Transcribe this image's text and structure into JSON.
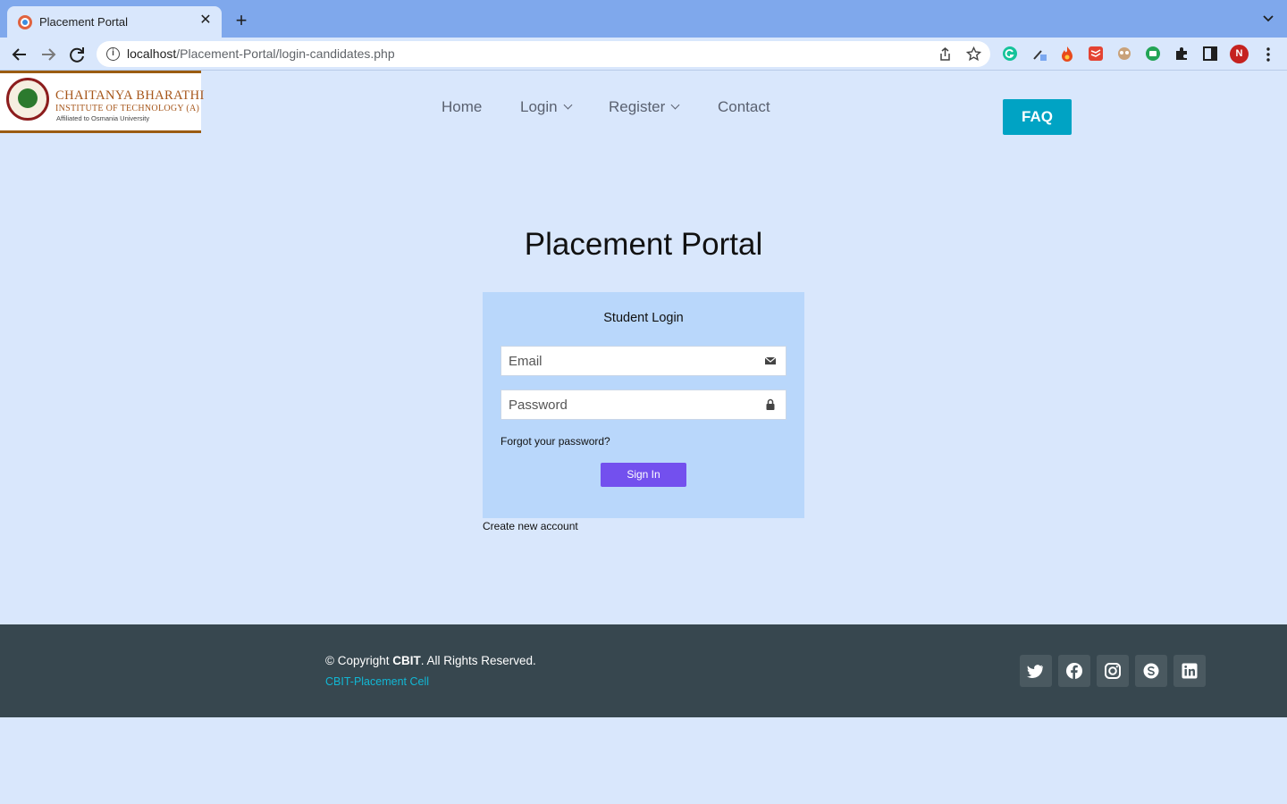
{
  "browser": {
    "tab_title": "Placement Portal",
    "url_host": "localhost",
    "url_path": "/Placement-Portal/login-candidates.php",
    "avatar_initial": "N"
  },
  "header": {
    "logo_title": "CHAITANYA BHARATHI",
    "logo_subtitle": "INSTITUTE OF TECHNOLOGY (A)",
    "logo_affiliation": "Affiliated to Osmania University",
    "nav": {
      "home": "Home",
      "login": "Login",
      "register": "Register",
      "contact": "Contact"
    },
    "faq_label": "FAQ"
  },
  "main": {
    "page_title": "Placement Portal",
    "card_title": "Student Login",
    "email_placeholder": "Email",
    "password_placeholder": "Password",
    "forgot_label": "Forgot your password?",
    "signin_label": "Sign In",
    "create_account_label": "Create new account"
  },
  "footer": {
    "copyright_prefix": "© Copyright ",
    "copyright_brand": "CBIT",
    "copyright_suffix": ". All Rights Reserved.",
    "credit": "CBIT-Placement Cell",
    "social_icons": [
      "twitter-icon",
      "facebook-icon",
      "instagram-icon",
      "skype-icon",
      "linkedin-icon"
    ]
  },
  "colors": {
    "page_bg": "#d9e7fc",
    "card_bg": "#b9d7fb",
    "faq_bg": "#00a3c4",
    "signin_bg": "#7350ee",
    "footer_bg": "#37474f",
    "credit_color": "#12b7d4"
  }
}
